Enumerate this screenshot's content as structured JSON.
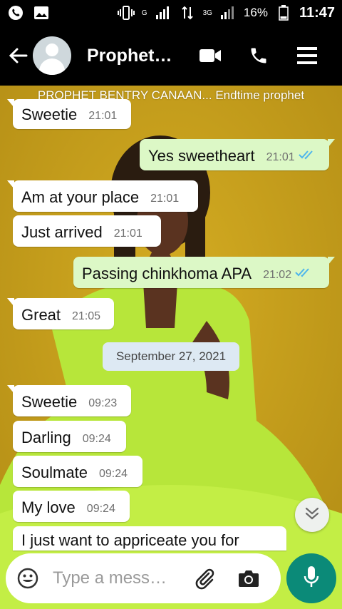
{
  "status_bar": {
    "battery": "16%",
    "time": "11:47",
    "network_g": "G",
    "network_3g": "3G"
  },
  "header": {
    "contact_name": "Prophet…",
    "subtitle": "PROPHET BENTRY CANAAN... Endtime prophet",
    "icons": [
      "back-arrow-icon",
      "video-call-icon",
      "voice-call-icon",
      "menu-icon"
    ]
  },
  "messages": [
    {
      "dir": "in",
      "text": "Sweetie",
      "time": "21:01"
    },
    {
      "dir": "out",
      "text": "Yes sweetheart",
      "time": "21:01",
      "read": true
    },
    {
      "dir": "in",
      "text": "Am at your place",
      "time": "21:01"
    },
    {
      "dir": "in",
      "text": "Just arrived",
      "time": "21:01"
    },
    {
      "dir": "out",
      "text": "Passing chinkhoma APA",
      "time": "21:02",
      "read": true
    },
    {
      "dir": "in",
      "text": "Great",
      "time": "21:05"
    },
    {
      "dir": "in",
      "text": "Sweetie",
      "time": "09:23"
    },
    {
      "dir": "in",
      "text": "Darling",
      "time": "09:24"
    },
    {
      "dir": "in",
      "text": "Soulmate",
      "time": "09:24"
    },
    {
      "dir": "in",
      "text": "My love",
      "time": "09:24"
    },
    {
      "dir": "in",
      "text": "I just want to appriceate you for",
      "time": ""
    }
  ],
  "date_separator": "September 27, 2021",
  "composer": {
    "placeholder": "Type a mess…"
  },
  "colors": {
    "header_bg": "#000000",
    "outgoing_bubble": "#dcf8c6",
    "incoming_bubble": "#ffffff",
    "tick_blue": "#4fb6ec",
    "mic_button": "#0b8a78"
  }
}
